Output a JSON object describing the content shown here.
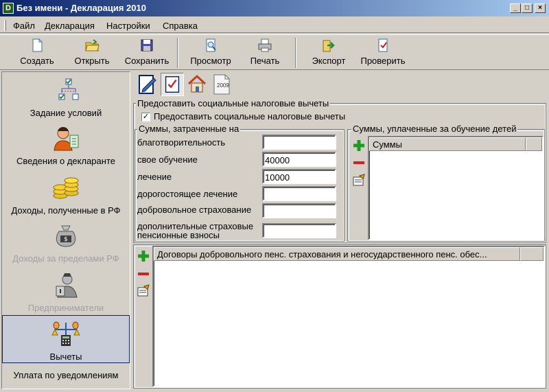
{
  "window": {
    "title": "Без имени - Декларация 2010",
    "icon_letter": "D"
  },
  "window_controls": {
    "minimize": "_",
    "maximize": "□",
    "close": "×"
  },
  "menu": [
    "Файл",
    "Декларация",
    "Настройки",
    "Справка"
  ],
  "toolbar": {
    "create": "Создать",
    "open": "Открыть",
    "save": "Сохранить",
    "preview": "Просмотр",
    "print": "Печать",
    "export": "Экспорт",
    "check": "Проверить"
  },
  "sidebar": {
    "items": [
      {
        "label": "Задание условий",
        "enabled": true
      },
      {
        "label": "Сведения о декларанте",
        "enabled": true
      },
      {
        "label": "Доходы, полученные в РФ",
        "enabled": true
      },
      {
        "label": "Доходы за пределами РФ",
        "enabled": false
      },
      {
        "label": "Предприниматели",
        "enabled": false
      },
      {
        "label": "Вычеты",
        "enabled": true,
        "selected": true
      },
      {
        "label": "Уплата по уведомлениям",
        "enabled": true
      }
    ]
  },
  "tabs": {
    "year_icon_text": "2009"
  },
  "social": {
    "group_title": "Предоставить социальные налоговые вычеты",
    "checkbox_label": "Предоставить социальные налоговые вычеты",
    "checkbox_checked": true
  },
  "sums_spent": {
    "group_title": "Суммы, затраченные на",
    "rows": [
      {
        "label": "благотворительность",
        "value": ""
      },
      {
        "label": "свое обучение",
        "value": "40000"
      },
      {
        "label": "лечение",
        "value": "10000"
      },
      {
        "label": "дорогостоящее лечение",
        "value": ""
      },
      {
        "label": "добровольное страхование",
        "value": ""
      },
      {
        "label_line1": "дополнительные страховые",
        "label_line2": "пенсионные взносы",
        "value": ""
      }
    ]
  },
  "children_edu": {
    "group_title": "Суммы, уплаченные за обучение детей",
    "column": "Суммы"
  },
  "contracts": {
    "column": "Договоры добровольного пенс. страхования и негосударственного пенс. обес..."
  }
}
